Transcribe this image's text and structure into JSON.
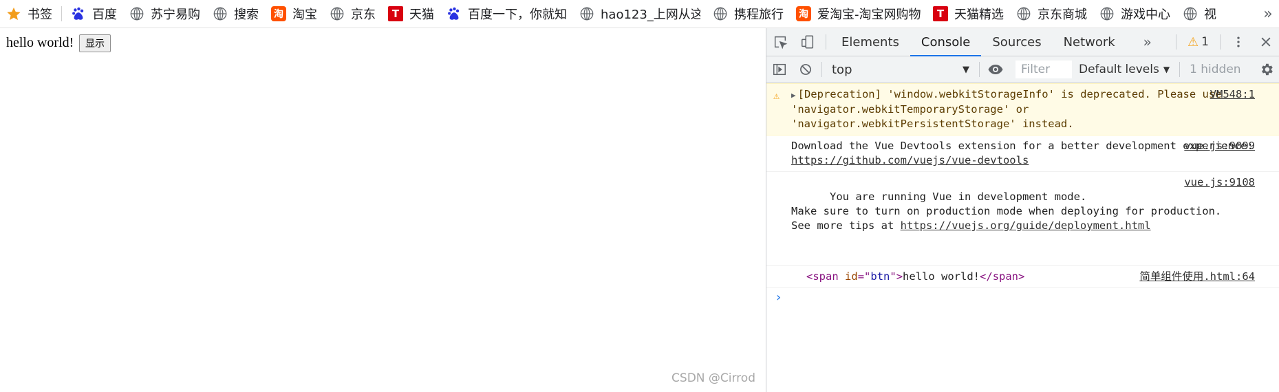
{
  "bookmarks": [
    {
      "label": "书签",
      "icon": "star-icon"
    },
    {
      "label": "百度",
      "icon": "baidu-paw-icon"
    },
    {
      "label": "苏宁易购",
      "icon": "globe-icon"
    },
    {
      "label": "搜索",
      "icon": "globe-icon"
    },
    {
      "label": "淘宝",
      "icon": "taobao-icon"
    },
    {
      "label": "京东",
      "icon": "globe-icon"
    },
    {
      "label": "天猫",
      "icon": "tmall-icon"
    },
    {
      "label": "百度一下，你就知",
      "icon": "baidu-paw-icon"
    },
    {
      "label": "hao123_上网从这",
      "icon": "globe-icon"
    },
    {
      "label": "携程旅行",
      "icon": "globe-icon"
    },
    {
      "label": "爱淘宝-淘宝网购物",
      "icon": "taobao-icon"
    },
    {
      "label": "天猫精选",
      "icon": "tmall-icon"
    },
    {
      "label": "京东商城",
      "icon": "globe-icon"
    },
    {
      "label": "游戏中心",
      "icon": "globe-icon"
    },
    {
      "label": "视",
      "icon": "globe-icon"
    }
  ],
  "bookmarks_more": "»",
  "taobao_glyph": "淘",
  "tmall_glyph": "T",
  "page": {
    "text": "hello world!",
    "button_label": "显示"
  },
  "watermark": "CSDN @Cirrod",
  "devtools": {
    "tabs": [
      "Elements",
      "Console",
      "Sources",
      "Network"
    ],
    "active_tab": "Console",
    "more_tabs": "»",
    "warning_count": "1",
    "toolbar": {
      "context": "top",
      "filter_placeholder": "Filter",
      "levels": "Default levels",
      "hidden": "1 hidden"
    },
    "messages": [
      {
        "kind": "warning",
        "text": "[Deprecation] 'window.webkitStorageInfo' is deprecated. Please use 'navigator.webkitTemporaryStorage' or 'navigator.webkitPersistentStorage' instead.",
        "source": "VM548:1"
      },
      {
        "kind": "log",
        "text": "Download the Vue Devtools extension for a better development experience:",
        "link": "https://github.com/vuejs/vue-devtools",
        "source": "vue.js:9099"
      },
      {
        "kind": "log",
        "text": "You are running Vue in development mode.\nMake sure to turn on production mode when deploying for production.\nSee more tips at ",
        "link": "https://vuejs.org/guide/deployment.html",
        "source": "vue.js:9108"
      },
      {
        "kind": "element",
        "tag": "span",
        "attr_name": "id",
        "attr_value": "btn",
        "inner": "hello world!",
        "source": "简单组件使用.html:64"
      }
    ],
    "prompt": "›"
  },
  "colors": {
    "accent": "#1a73e8",
    "warning": "#f5a623",
    "warning_bg": "#fffbe6"
  }
}
